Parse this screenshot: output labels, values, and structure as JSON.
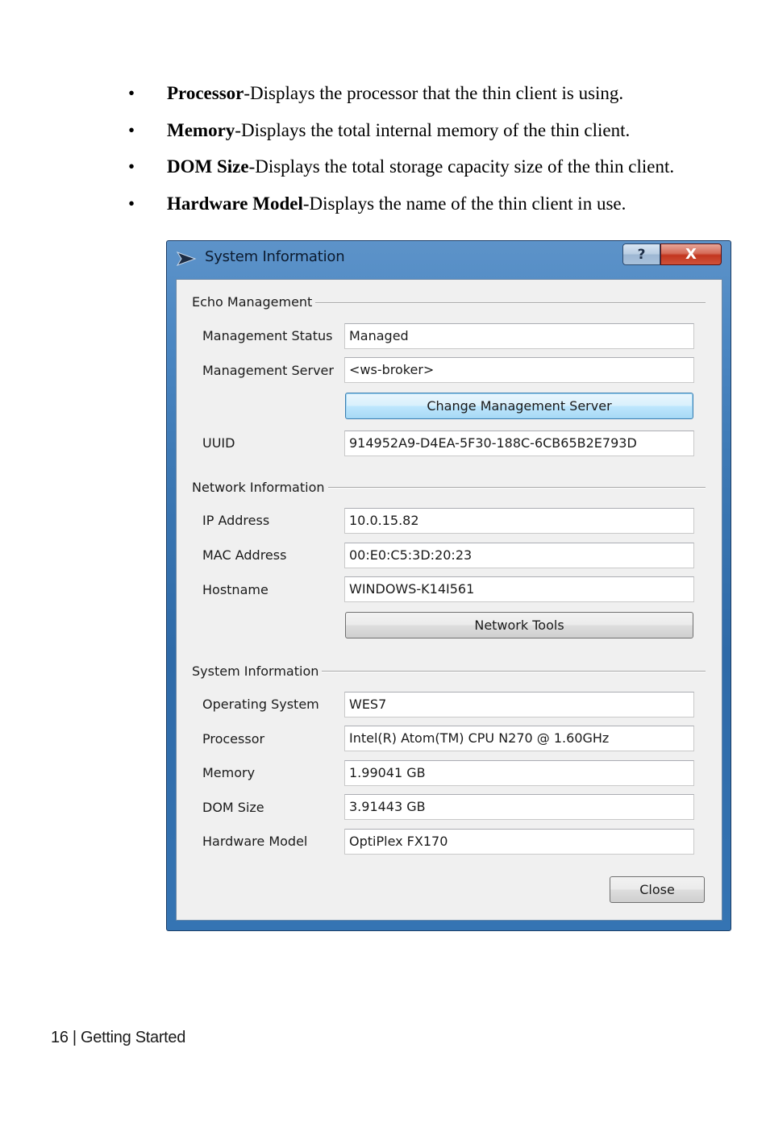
{
  "bullets": [
    {
      "term": "Processor",
      "desc": "-Displays the processor that the thin client is using."
    },
    {
      "term": "Memory",
      "desc": "-Displays the total internal memory of the thin client."
    },
    {
      "term": "DOM Size",
      "desc": "-Displays the total storage capacity size of the thin client."
    },
    {
      "term": "Hardware Model",
      "desc": "-Displays the name of the thin client in use."
    }
  ],
  "window": {
    "title": "System Information",
    "help_glyph": "?",
    "close_glyph": "X"
  },
  "echo": {
    "title": "Echo Management",
    "status_label": "Management Status",
    "status_value": "Managed",
    "server_label": "Management Server",
    "server_value": "<ws-broker>",
    "change_button": "Change Management Server",
    "uuid_label": "UUID",
    "uuid_value": "914952A9-D4EA-5F30-188C-6CB65B2E793D"
  },
  "network": {
    "title": "Network Information",
    "ip_label": "IP Address",
    "ip_value": "10.0.15.82",
    "mac_label": "MAC Address",
    "mac_value": "00:E0:C5:3D:20:23",
    "host_label": "Hostname",
    "host_value": "WINDOWS-K14I561",
    "tools_button": "Network Tools"
  },
  "system": {
    "title": "System Information",
    "os_label": "Operating System",
    "os_value": "WES7",
    "proc_label": "Processor",
    "proc_value": "Intel(R) Atom(TM) CPU N270   @ 1.60GHz",
    "mem_label": "Memory",
    "mem_value": "1.99041 GB",
    "dom_label": "DOM Size",
    "dom_value": "3.91443 GB",
    "hw_label": "Hardware Model",
    "hw_value": "OptiPlex FX170"
  },
  "close_button": "Close",
  "footer": "16 | Getting Started",
  "colors": {
    "title_bar": "#3b77b3",
    "client_bg": "#f0f0f0",
    "close_button_red": "#c2361f"
  }
}
